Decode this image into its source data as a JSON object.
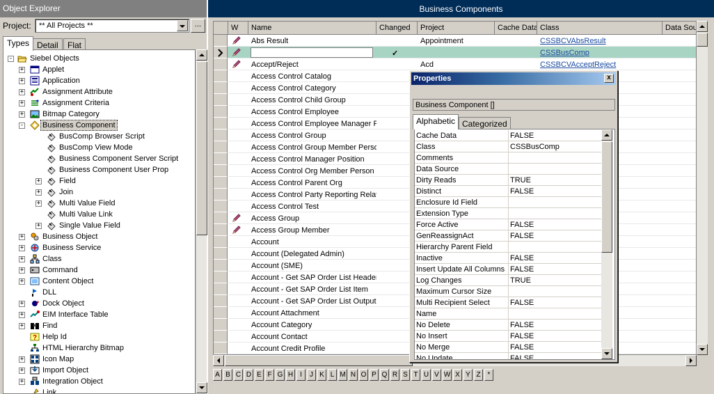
{
  "explorer": {
    "title": "Object Explorer",
    "project_label": "Project:",
    "project_value": "** All Projects **",
    "browse_label": "...",
    "tabs": [
      {
        "label": "Types",
        "active": true
      },
      {
        "label": "Detail",
        "active": false
      },
      {
        "label": "Flat",
        "active": false
      }
    ],
    "tree": [
      {
        "label": "Siebel Objects",
        "level": 0,
        "exp": "-",
        "icon": "folder-open-icon",
        "selected": false
      },
      {
        "label": "Applet",
        "level": 1,
        "exp": "+",
        "icon": "applet-icon",
        "selected": false
      },
      {
        "label": "Application",
        "level": 1,
        "exp": "+",
        "icon": "application-icon",
        "selected": false
      },
      {
        "label": "Assignment Attribute",
        "level": 1,
        "exp": "+",
        "icon": "assignment-attribute-icon",
        "selected": false
      },
      {
        "label": "Assignment Criteria",
        "level": 1,
        "exp": "+",
        "icon": "assignment-criteria-icon",
        "selected": false
      },
      {
        "label": "Bitmap Category",
        "level": 1,
        "exp": "+",
        "icon": "bitmap-category-icon",
        "selected": false
      },
      {
        "label": "Business Component",
        "level": 1,
        "exp": "-",
        "icon": "business-component-icon",
        "selected": true
      },
      {
        "label": "BusComp Browser Script",
        "level": 2,
        "exp": "",
        "icon": "child-object-icon",
        "selected": false
      },
      {
        "label": "BusComp View Mode",
        "level": 2,
        "exp": "",
        "icon": "child-object-icon",
        "selected": false
      },
      {
        "label": "Business Component Server Script",
        "level": 2,
        "exp": "",
        "icon": "child-object-icon",
        "selected": false
      },
      {
        "label": "Business Component User Prop",
        "level": 2,
        "exp": "",
        "icon": "child-object-icon",
        "selected": false
      },
      {
        "label": "Field",
        "level": 2,
        "exp": "+",
        "icon": "child-object-icon",
        "selected": false
      },
      {
        "label": "Join",
        "level": 2,
        "exp": "+",
        "icon": "child-object-icon",
        "selected": false
      },
      {
        "label": "Multi Value Field",
        "level": 2,
        "exp": "+",
        "icon": "child-object-icon",
        "selected": false
      },
      {
        "label": "Multi Value Link",
        "level": 2,
        "exp": "",
        "icon": "child-object-icon",
        "selected": false
      },
      {
        "label": "Single Value Field",
        "level": 2,
        "exp": "+",
        "icon": "child-object-icon",
        "selected": false
      },
      {
        "label": "Business Object",
        "level": 1,
        "exp": "+",
        "icon": "business-object-icon",
        "selected": false
      },
      {
        "label": "Business Service",
        "level": 1,
        "exp": "+",
        "icon": "business-service-icon",
        "selected": false
      },
      {
        "label": "Class",
        "level": 1,
        "exp": "+",
        "icon": "class-icon",
        "selected": false
      },
      {
        "label": "Command",
        "level": 1,
        "exp": "+",
        "icon": "command-icon",
        "selected": false
      },
      {
        "label": "Content Object",
        "level": 1,
        "exp": "+",
        "icon": "content-object-icon",
        "selected": false
      },
      {
        "label": "DLL",
        "level": 1,
        "exp": "",
        "icon": "dll-icon",
        "selected": false
      },
      {
        "label": "Dock Object",
        "level": 1,
        "exp": "+",
        "icon": "dock-object-icon",
        "selected": false
      },
      {
        "label": "EIM Interface Table",
        "level": 1,
        "exp": "+",
        "icon": "eim-interface-table-icon",
        "selected": false
      },
      {
        "label": "Find",
        "level": 1,
        "exp": "+",
        "icon": "find-icon",
        "selected": false
      },
      {
        "label": "Help Id",
        "level": 1,
        "exp": "",
        "icon": "help-id-icon",
        "selected": false
      },
      {
        "label": "HTML Hierarchy Bitmap",
        "level": 1,
        "exp": "",
        "icon": "html-hierarchy-bitmap-icon",
        "selected": false
      },
      {
        "label": "Icon Map",
        "level": 1,
        "exp": "+",
        "icon": "icon-map-icon",
        "selected": false
      },
      {
        "label": "Import Object",
        "level": 1,
        "exp": "+",
        "icon": "import-object-icon",
        "selected": false
      },
      {
        "label": "Integration Object",
        "level": 1,
        "exp": "+",
        "icon": "integration-object-icon",
        "selected": false
      },
      {
        "label": "Link",
        "level": 1,
        "exp": "",
        "icon": "link-icon",
        "selected": false
      }
    ]
  },
  "bc": {
    "title": "Business Components",
    "columns": [
      {
        "label": "",
        "key": "sel"
      },
      {
        "label": "W",
        "key": "w"
      },
      {
        "label": "Name",
        "key": "name"
      },
      {
        "label": "Changed",
        "key": "changed"
      },
      {
        "label": "Project",
        "key": "project"
      },
      {
        "label": "Cache Data",
        "key": "cache"
      },
      {
        "label": "Class",
        "key": "class"
      },
      {
        "label": "Data Sourc",
        "key": "datasource"
      }
    ],
    "rows": [
      {
        "pencil": true,
        "name": "Abs Result",
        "changed": "",
        "project": "Appointment",
        "class": "CSSBCVAbsResult",
        "current": false,
        "editing": false
      },
      {
        "pencil": true,
        "name": "",
        "changed": "✓",
        "project": "",
        "class": "CSSBusComp",
        "current": true,
        "editing": true
      },
      {
        "pencil": true,
        "name": "Accept/Reject",
        "changed": "",
        "project": "Acd",
        "class": "CSSBCVAcceptReject",
        "current": false,
        "editing": false
      },
      {
        "pencil": false,
        "name": "Access Control Catalog",
        "changed": "",
        "project": "",
        "class": "",
        "current": false,
        "editing": false
      },
      {
        "pencil": false,
        "name": "Access Control Category",
        "changed": "",
        "project": "",
        "class": "",
        "current": false,
        "editing": false
      },
      {
        "pencil": false,
        "name": "Access Control Child Group",
        "changed": "",
        "project": "",
        "class": "",
        "current": false,
        "editing": false
      },
      {
        "pencil": false,
        "name": "Access Control Employee",
        "changed": "",
        "project": "",
        "class": "",
        "current": false,
        "editing": false
      },
      {
        "pencil": false,
        "name": "Access Control Employee Manager Po",
        "changed": "",
        "project": "",
        "class": "",
        "current": false,
        "editing": false
      },
      {
        "pencil": false,
        "name": "Access Control Group",
        "changed": "",
        "project": "",
        "class": "",
        "current": false,
        "editing": false
      },
      {
        "pencil": false,
        "name": "Access Control Group Member Person",
        "changed": "",
        "project": "",
        "class": "",
        "current": false,
        "editing": false
      },
      {
        "pencil": false,
        "name": "Access Control Manager Position",
        "changed": "",
        "project": "",
        "class": "",
        "current": false,
        "editing": false
      },
      {
        "pencil": false,
        "name": "Access Control Org Member Person",
        "changed": "",
        "project": "",
        "class": "",
        "current": false,
        "editing": false
      },
      {
        "pencil": false,
        "name": "Access Control Parent Org",
        "changed": "",
        "project": "",
        "class": "",
        "current": false,
        "editing": false
      },
      {
        "pencil": false,
        "name": "Access Control Party Reporting Relatic",
        "changed": "",
        "project": "",
        "class": "",
        "current": false,
        "editing": false
      },
      {
        "pencil": false,
        "name": "Access Control Test",
        "changed": "",
        "project": "",
        "class": "",
        "current": false,
        "editing": false
      },
      {
        "pencil": true,
        "name": "Access Group",
        "changed": "",
        "project": "",
        "class": "",
        "current": false,
        "editing": false
      },
      {
        "pencil": true,
        "name": "Access Group Member",
        "changed": "",
        "project": "",
        "class": "",
        "current": false,
        "editing": false
      },
      {
        "pencil": false,
        "name": "Account",
        "changed": "",
        "project": "",
        "class": "",
        "current": false,
        "editing": false
      },
      {
        "pencil": false,
        "name": "Account (Delegated Admin)",
        "changed": "",
        "project": "",
        "class": "",
        "current": false,
        "editing": false
      },
      {
        "pencil": false,
        "name": "Account (SME)",
        "changed": "",
        "project": "",
        "class": "",
        "current": false,
        "editing": false
      },
      {
        "pencil": false,
        "name": "Account - Get SAP Order List Header",
        "changed": "",
        "project": "",
        "class": "",
        "current": false,
        "editing": false
      },
      {
        "pencil": false,
        "name": "Account - Get SAP Order List Item",
        "changed": "",
        "project": "",
        "class": "",
        "current": false,
        "editing": false
      },
      {
        "pencil": false,
        "name": "Account - Get SAP Order List Output",
        "changed": "",
        "project": "",
        "class": "",
        "current": false,
        "editing": false
      },
      {
        "pencil": false,
        "name": "Account Attachment",
        "changed": "",
        "project": "",
        "class": "",
        "current": false,
        "editing": false
      },
      {
        "pencil": false,
        "name": "Account Category",
        "changed": "",
        "project": "",
        "class": "",
        "current": false,
        "editing": false
      },
      {
        "pencil": false,
        "name": "Account Contact",
        "changed": "",
        "project": "",
        "class": "",
        "current": false,
        "editing": false
      },
      {
        "pencil": false,
        "name": "Account Credit Profile",
        "changed": "",
        "project": "",
        "class": "",
        "current": false,
        "editing": false
      }
    ],
    "alphabet": [
      "A",
      "B",
      "C",
      "D",
      "E",
      "F",
      "G",
      "H",
      "I",
      "J",
      "K",
      "L",
      "M",
      "N",
      "O",
      "P",
      "Q",
      "R",
      "S",
      "T",
      "U",
      "V",
      "W",
      "X",
      "Y",
      "Z",
      "*"
    ]
  },
  "props": {
    "title": "Properties",
    "close_label": "x",
    "object_label": "Business Component []",
    "tabs": [
      {
        "label": "Alphabetic",
        "active": true
      },
      {
        "label": "Categorized",
        "active": false
      }
    ],
    "rows": [
      {
        "name": "Cache Data",
        "value": "FALSE"
      },
      {
        "name": "Class",
        "value": "CSSBusComp"
      },
      {
        "name": "Comments",
        "value": ""
      },
      {
        "name": "Data Source",
        "value": ""
      },
      {
        "name": "Dirty Reads",
        "value": "TRUE"
      },
      {
        "name": "Distinct",
        "value": "FALSE"
      },
      {
        "name": "Enclosure Id Field",
        "value": ""
      },
      {
        "name": "Extension Type",
        "value": ""
      },
      {
        "name": "Force Active",
        "value": "FALSE"
      },
      {
        "name": "GenReassignAct",
        "value": "FALSE"
      },
      {
        "name": "Hierarchy Parent Field",
        "value": ""
      },
      {
        "name": "Inactive",
        "value": "FALSE"
      },
      {
        "name": "Insert Update All Columns",
        "value": "FALSE"
      },
      {
        "name": "Log Changes",
        "value": "TRUE"
      },
      {
        "name": "Maximum Cursor Size",
        "value": ""
      },
      {
        "name": "Multi Recipient Select",
        "value": "FALSE"
      },
      {
        "name": "Name",
        "value": ""
      },
      {
        "name": "No Delete",
        "value": "FALSE"
      },
      {
        "name": "No Insert",
        "value": "FALSE"
      },
      {
        "name": "No Merge",
        "value": "FALSE"
      },
      {
        "name": "No Update",
        "value": "FALSE"
      }
    ]
  }
}
